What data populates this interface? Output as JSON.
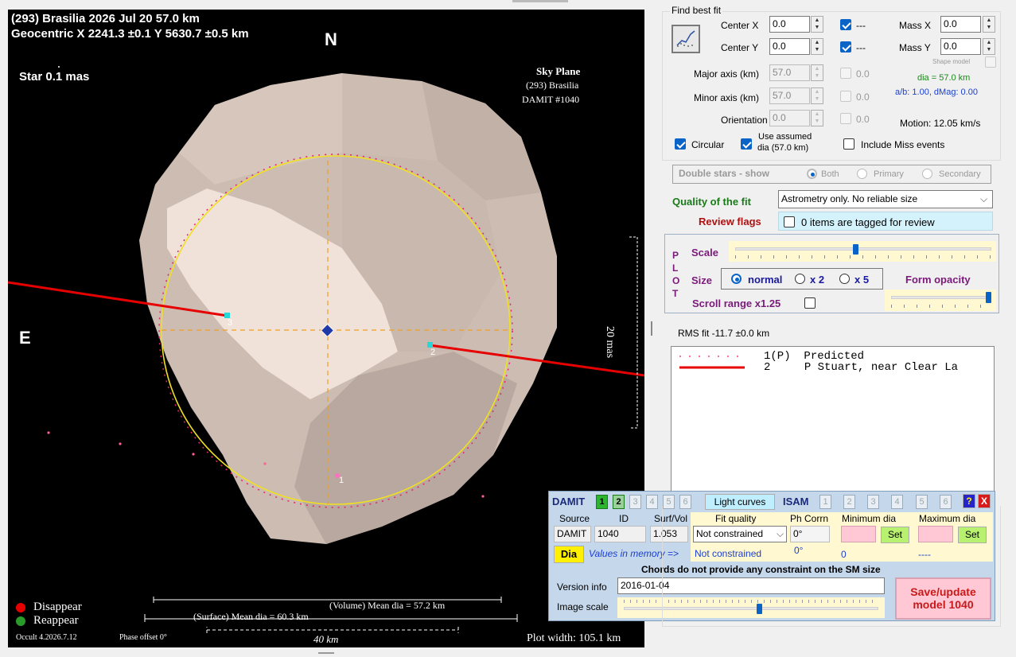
{
  "plot": {
    "header_line1": "(293) Brasilia  2026 Jul 20  57.0 km",
    "header_line2": "Geocentric  X  2241.3 ±0.1  Y 5630.7 ±0.5 km",
    "north_label": "N",
    "east_label": "E",
    "star_label": "Star 0.1 mas",
    "sky_plane_title": "Sky Plane",
    "sky_plane_object": "(293) Brasilia",
    "sky_plane_model": "DAMIT #1040",
    "scale_mas": "20 mas",
    "chord_1_label": "1",
    "chord_2_label": "2",
    "chord_3_label": "3",
    "legend_disappear": "Disappear",
    "legend_reappear": "Reappear",
    "volume_dia": "(Volume) Mean dia = 57.2 km",
    "surface_dia": "(Surface) Mean dia = 60.3 km",
    "version": "Occult 4.2026.7.12",
    "phase_offset": "Phase offset 0°",
    "scale_km": "40 km",
    "plot_width": "Plot width: 105.1 km",
    "colors": {
      "disappear": "#e60000",
      "reappear": "#2a9a2a",
      "chord": "#e60000",
      "fit_circle": "#f0e020"
    }
  },
  "fit": {
    "group_title": "Find best fit",
    "center_x_label": "Center X",
    "center_x_value": "0.0",
    "center_y_label": "Center Y",
    "center_y_value": "0.0",
    "dash1": "---",
    "dash2": "---",
    "mass_x_label": "Mass X",
    "mass_x_value": "0.0",
    "mass_y_label": "Mass Y",
    "mass_y_value": "0.0",
    "shape_model_label": "Shape model",
    "major_label": "Major axis (km)",
    "major_value": "57.0",
    "major_ext": "0.0",
    "minor_label": "Minor axis (km)",
    "minor_value": "57.0",
    "minor_ext": "0.0",
    "orient_label": "Orientation",
    "orient_value": "0.0",
    "orient_ext": "0.0",
    "dia_text": "dia = 57.0 km",
    "ab_text": "a/b: 1.00, dMag: 0.00",
    "motion_text": "Motion: 12.05 km/s",
    "circular_label": "Circular",
    "use_assumed_1": "Use assumed",
    "use_assumed_2": "dia (57.0 km)",
    "include_miss": "Include Miss events",
    "double_stars": "Double stars - show",
    "both": "Both",
    "primary": "Primary",
    "secondary": "Secondary",
    "quality_label": "Quality of the fit",
    "quality_value": "Astrometry only. No reliable size",
    "review_label": "Review flags",
    "review_value": "0 items are tagged for review"
  },
  "plotctl": {
    "plot_letters": [
      "P",
      "L",
      "O",
      "T"
    ],
    "scale_label": "Scale",
    "size_label": "Size",
    "normal": "normal",
    "x2": "x 2",
    "x5": "x 5",
    "form_opacity": "Form opacity",
    "scroll_range": "Scroll range x1.25",
    "scale_fraction": 0.47,
    "opacity_fraction": 0.97
  },
  "rms": "RMS fit -11.7 ±0.0 km",
  "observers": [
    {
      "num": "1(P)",
      "name": "Predicted"
    },
    {
      "num": "2",
      "name": "P Stuart, near Clear La"
    }
  ],
  "damit": {
    "title": "DAMIT",
    "models": [
      "1",
      "2",
      "3",
      "4",
      "5",
      "6"
    ],
    "light_curves": "Light curves",
    "isam": "ISAM",
    "isam_models": [
      "1",
      "2",
      "3",
      "4",
      "5",
      "6"
    ],
    "help": "?",
    "close": "X",
    "col_source": "Source",
    "col_id": "ID",
    "col_surfvol": "Surf/Vol",
    "col_fitq": "Fit quality",
    "col_phcorr": "Ph Corrn",
    "col_mindia": "Minimum dia",
    "col_maxdia": "Maximum dia",
    "source": "DAMIT",
    "id": "1040",
    "surfvol": "1.053",
    "fitq": "Not constrained",
    "phcorr": "0°",
    "set": "Set",
    "dia_button": "Dia",
    "values_mem": "Values in memory =>",
    "mem_fitq": "Not constrained",
    "mem_phcorr": "0°",
    "mem_min": "0",
    "mem_max": "----",
    "chords_msg": "Chords do not provide any constraint on the SM size",
    "version_label": "Version info",
    "version_value": "2016-01-04",
    "image_scale": "Image scale",
    "save_1": "Save/update",
    "save_2": "model 1040",
    "image_scale_fraction": 0.53
  }
}
